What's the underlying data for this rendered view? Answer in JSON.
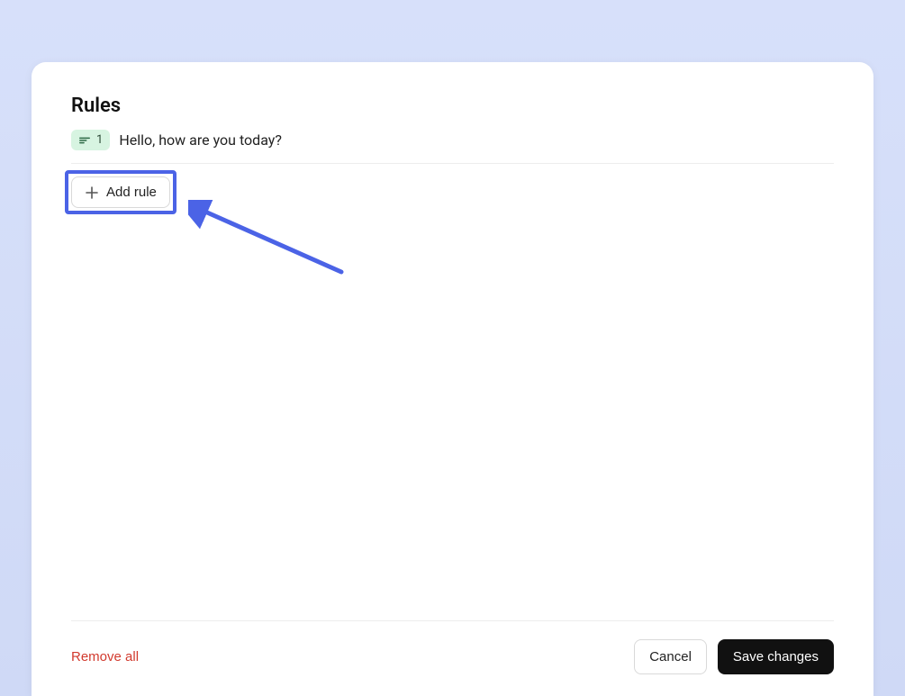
{
  "card": {
    "title": "Rules"
  },
  "rule": {
    "index": "1",
    "text": "Hello, how are you today?"
  },
  "buttons": {
    "add_rule": "Add rule",
    "remove_all": "Remove all",
    "cancel": "Cancel",
    "save": "Save changes"
  },
  "colors": {
    "highlight": "#4b63e6",
    "danger": "#d23a2e"
  }
}
